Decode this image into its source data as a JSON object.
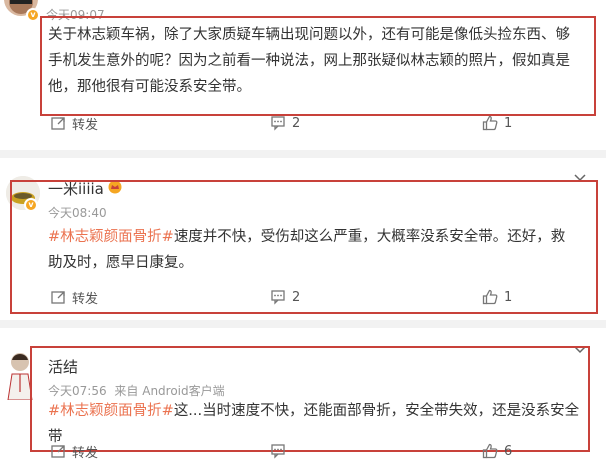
{
  "comments": [
    {
      "username": "",
      "time": "今天09:07",
      "source": "",
      "hashtag": "",
      "text": "关于林志颖车祸，除了大家质疑车辆出现问题以外，还有可能是像低头捡东西、够手机发生意外的呢？因为之前看一种说法，网上那张疑似林志颖的照片，假如真是他，那他很有可能没系安全带。",
      "repost_label": "转发",
      "comment_count": "2",
      "like_count": "1"
    },
    {
      "username": "一米iiiia",
      "time": "今天08:40",
      "source": "",
      "hashtag": "#林志颖颜面骨折#",
      "text": "速度并不快，受伤却这么严重，大概率没系安全带。还好，救助及时，愿早日康复。",
      "repost_label": "转发",
      "comment_count": "2",
      "like_count": "1"
    },
    {
      "username": "活结",
      "time": "今天07:56",
      "source": "来自 Android客户端",
      "hashtag": "#林志颖颜面骨折#",
      "text": "这...当时速度不快，还能面部骨折，安全带失效，还是没系安全带",
      "repost_label": "转发",
      "comment_count": "",
      "like_count": "6"
    }
  ],
  "colors": {
    "accent": "#eb7350",
    "highlight_box": "#c8413a",
    "badge": "#f5a623"
  },
  "icons": [
    "repost-icon",
    "comment-icon",
    "like-icon",
    "chevron-down-icon",
    "vip-badge-icon"
  ]
}
